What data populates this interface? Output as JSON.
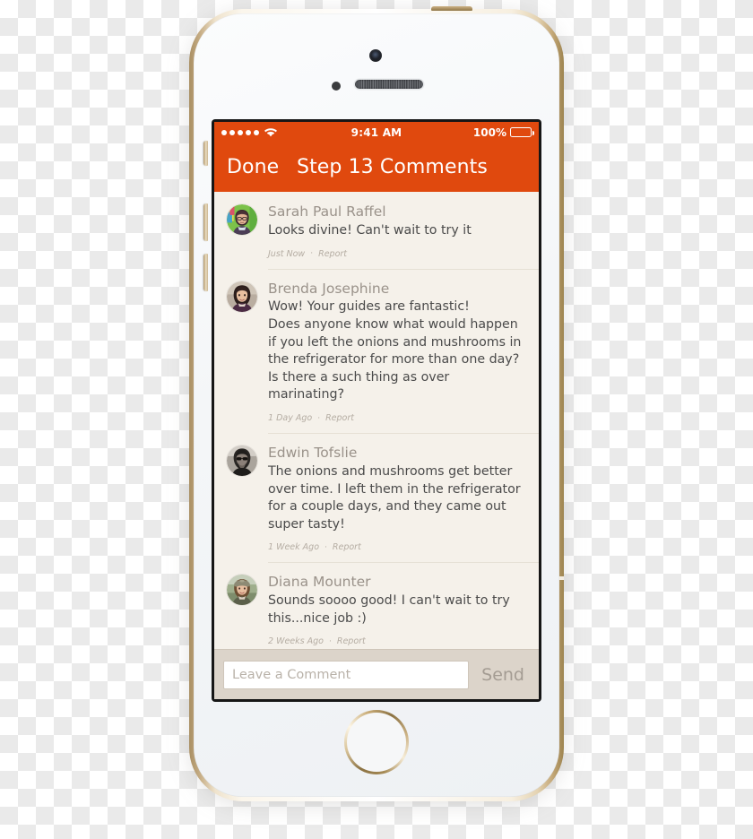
{
  "device": {
    "model_name": "iphone-5s-gold",
    "hardware": {
      "front_camera": "front-camera",
      "proximity_sensor": "proximity-sensor",
      "earpiece": "earpiece-speaker",
      "home_button": "home-button",
      "power_button": "power-button",
      "mute_switch": "mute-switch",
      "volume_up": "volume-up-button",
      "volume_down": "volume-down-button"
    }
  },
  "colors": {
    "accent_orange": "#E0490E",
    "screen_background": "#F5F1EA",
    "composer_background": "#DCD4CA",
    "author_text": "#9A928A",
    "body_text": "#4A4A4A",
    "meta_text": "#B5ADA3",
    "separator": "#E6E0D5"
  },
  "status_bar": {
    "signal_dots": 5,
    "signal_dots_filled": 5,
    "wifi_icon": "wifi-icon",
    "time": "9:41 AM",
    "battery_percent": "100%",
    "battery_level": 100,
    "battery_icon": "battery-icon"
  },
  "nav_bar": {
    "done_label": "Done",
    "title": "Step 13 Comments"
  },
  "comments": [
    {
      "author": "Sarah Paul Raffel",
      "text": "Looks divine! Can't wait to try it",
      "time": "Just Now",
      "separator": "·",
      "report_label": "Report",
      "avatar": "avatar-sarah-paul-raffel"
    },
    {
      "author": "Brenda Josephine",
      "text": "Wow! Your guides are fantastic!\nDoes anyone know what would happen if you left the onions and mushrooms in the refrigerator for more than one day? Is there a such thing as over marinating?",
      "time": "1 Day Ago",
      "separator": "·",
      "report_label": "Report",
      "avatar": "avatar-brenda-josephine"
    },
    {
      "author": "Edwin Tofslie",
      "text": "The onions and mushrooms get better over time. I left them in the refrigerator for a couple days, and they came out super tasty!",
      "time": "1 Week Ago",
      "separator": "·",
      "report_label": "Report",
      "avatar": "avatar-edwin-tofslie"
    },
    {
      "author": "Diana Mounter",
      "text": "Sounds soooo good! I can't wait to try this...nice job :)",
      "time": "2 Weeks Ago",
      "separator": "·",
      "report_label": "Report",
      "avatar": "avatar-diana-mounter"
    }
  ],
  "composer": {
    "input_value": "",
    "input_placeholder": "Leave a Comment",
    "send_label": "Send"
  }
}
